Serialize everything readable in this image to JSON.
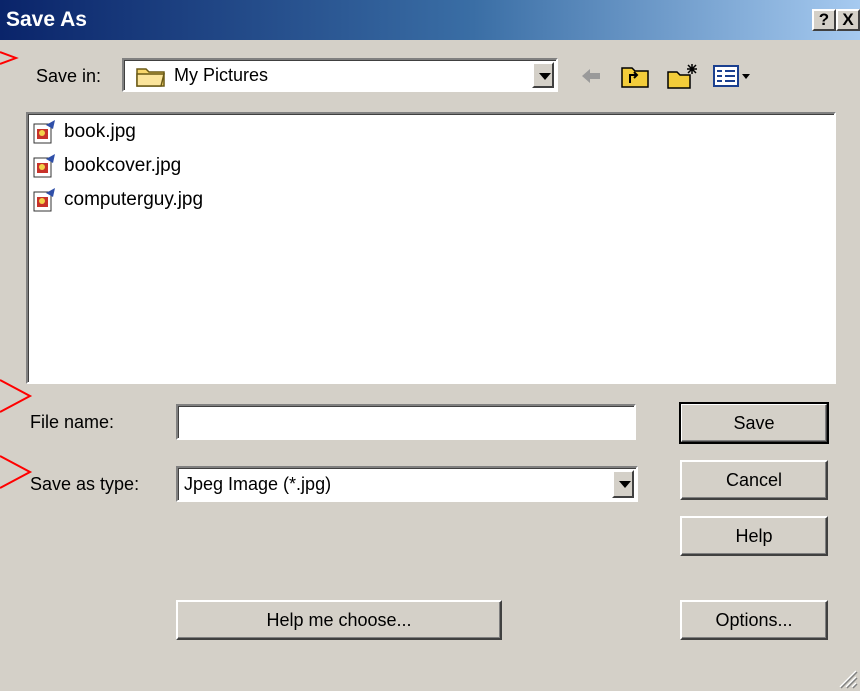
{
  "window": {
    "title": "Save As",
    "help_btn": "?",
    "close_btn": "X"
  },
  "save_in": {
    "label": "Save in:",
    "value": "My Pictures"
  },
  "toolbar": {
    "icons": [
      "back-arrow-icon",
      "up-folder-icon",
      "new-folder-icon",
      "view-menu-icon"
    ]
  },
  "files": [
    {
      "name": "book.jpg"
    },
    {
      "name": "bookcover.jpg"
    },
    {
      "name": "computerguy.jpg"
    }
  ],
  "file_name": {
    "label": "File name:",
    "value": ""
  },
  "save_as_type": {
    "label": "Save as type:",
    "value": "Jpeg Image (*.jpg)"
  },
  "buttons": {
    "save": "Save",
    "cancel": "Cancel",
    "help": "Help",
    "help_me_choose": "Help me choose...",
    "options": "Options..."
  },
  "colors": {
    "dialog_bg": "#d4d0c8",
    "title_start": "#0a246a",
    "title_end": "#a6caf0",
    "arrow": "#ff0000"
  }
}
